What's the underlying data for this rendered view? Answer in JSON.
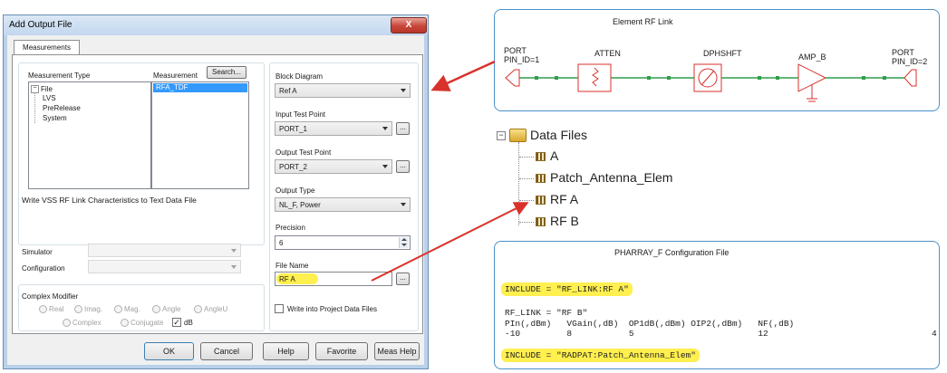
{
  "dialog": {
    "title": "Add Output File",
    "close_glyph": "X",
    "tab": "Measurements",
    "measurement_type_label": "Measurement Type",
    "measurement_label": "Measurement",
    "search_button": "Search...",
    "tree": {
      "root": "File",
      "root_toggle": "−",
      "children": [
        "LVS",
        "PreRelease",
        "System"
      ]
    },
    "measurement_items": [
      "RFA_TDF"
    ],
    "block_diagram": {
      "label": "Block Diagram",
      "value": "Ref A"
    },
    "input_test_point": {
      "label": "Input Test Point",
      "value": "PORT_1"
    },
    "output_test_point": {
      "label": "Output Test Point",
      "value": "PORT_2"
    },
    "output_type": {
      "label": "Output Type",
      "value": "NL_F, Power"
    },
    "precision": {
      "label": "Precision",
      "value": "6"
    },
    "file_name": {
      "label": "File Name",
      "value": "RF A"
    },
    "ellipsis": "...",
    "description": "Write VSS RF Link Characteristics to Text Data File",
    "simulator_label": "Simulator",
    "configuration_label": "Configuration",
    "complex_modifier": {
      "label": "Complex Modifier",
      "options_row1": [
        "Real",
        "Imag.",
        "Mag.",
        "Angle",
        "AngleU"
      ],
      "options_row2": [
        "Complex",
        "Conjugate"
      ],
      "db_label": "dB",
      "db_checked": true
    },
    "write_project_label": "Write into Project Data Files",
    "write_project_checked": false,
    "buttons": {
      "ok": "OK",
      "cancel": "Cancel",
      "help": "Help",
      "favorite": "Favorite",
      "meas_help": "Meas Help"
    }
  },
  "rf_link": {
    "title": "Element RF Link",
    "port_left": [
      "PORT",
      "PIN_ID=1"
    ],
    "atten": "ATTEN",
    "dphshft": "DPHSHFT",
    "amp": "AMP_B",
    "port_right": [
      "PORT",
      "PIN_ID=2"
    ]
  },
  "data_files": {
    "root": "Data Files",
    "root_toggle": "−",
    "items": [
      "A",
      "Patch_Antenna_Elem",
      "RF A",
      "RF B"
    ]
  },
  "config": {
    "title": "PHARRAY_F Configuration File",
    "line1": "INCLUDE = \"RF_LINK:RF A\"",
    "line2": "RF_LINK = \"RF B\"",
    "line3": "PIn(,dBm)   VGain(,dB)  OP1dB(,dBm) OIP2(,dBm)   NF(,dB)",
    "line4": "-10         8           5                        12",
    "line4_tail": "4",
    "line5": "INCLUDE = \"RADPAT:Patch_Antenna_Elem\""
  },
  "colors": {
    "arrow": "#d9322b",
    "highlight": "#ffef4f",
    "panel_border": "#4a90c8",
    "trace": "#2f9e4a",
    "component": "#d9322b"
  }
}
